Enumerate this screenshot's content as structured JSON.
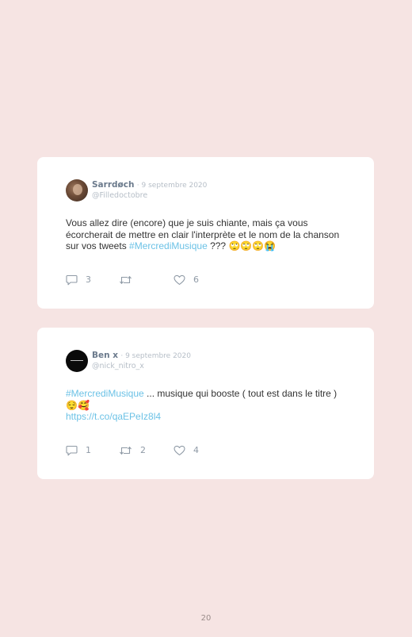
{
  "tweets": [
    {
      "author": "Sarrdøch",
      "date": "· 9 septembre 2020",
      "handle": "@Filledoctobre",
      "text_before": "Vous allez dire (encore) que je suis chiante, mais ça vous écorcherait de mettre en clair l'interprète et le nom de la chanson sur vos tweets ",
      "hashtag": "#MercrediMusique",
      "text_after": " ??? ",
      "emojis": "🙄🙄🙄😭",
      "replies": "3",
      "retweets": "",
      "likes": "6"
    },
    {
      "author": "Ben x",
      "date": "· 9 septembre 2020",
      "handle": "@nick_nitro_x",
      "hashtag": "#MercrediMusique",
      "text_after": " ... musique qui booste ( tout est dans le titre ) ",
      "emojis": "😌🥰",
      "url": "https://t.co/qaEPeIz8l4",
      "replies": "1",
      "retweets": "2",
      "likes": "4"
    }
  ],
  "page_number": "20",
  "colors": {
    "background": "#f6e4e3",
    "card": "#ffffff",
    "link": "#6cc2e6",
    "author": "#6b7a8c",
    "muted": "#b6bec7"
  },
  "icons": {
    "reply": "speech-bubble-icon",
    "retweet": "retweet-icon",
    "like": "heart-icon"
  }
}
